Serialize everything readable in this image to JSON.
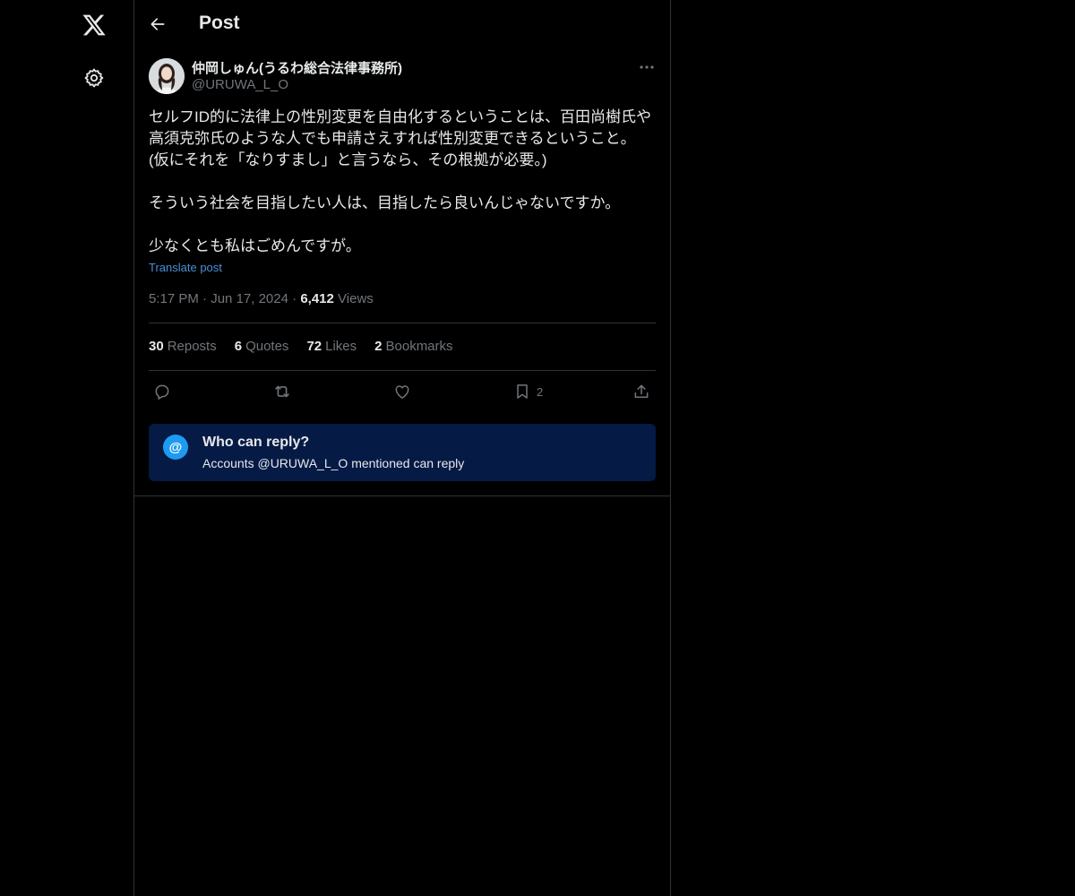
{
  "nav": {
    "logo_icon": "x-logo-icon",
    "settings_icon": "gear-icon"
  },
  "header": {
    "title": "Post",
    "back_icon": "arrow-left-icon"
  },
  "post": {
    "author": {
      "display_name": "仲岡しゅん(うるわ総合法律事務所)",
      "handle": "@URUWA_L_O"
    },
    "text_lines": [
      "セルフID的に法律上の性別変更を自由化するということは、百田尚樹氏や",
      "高須克弥氏のような人でも申請さえすれば性別変更できるということ。",
      "(仮にそれを「なりすまし」と言うなら、その根拠が必要。)",
      "",
      "そういう社会を目指したい人は、目指したら良いんじゃないですか。",
      "",
      "少なくとも私はごめんですが。"
    ],
    "translate_label": "Translate post",
    "time": "5:17 PM",
    "date": "Jun 17, 2024",
    "views_count": "6,412",
    "views_label": "Views",
    "stats": {
      "reposts_count": "30",
      "reposts_label": "Reposts",
      "quotes_count": "6",
      "quotes_label": "Quotes",
      "likes_count": "72",
      "likes_label": "Likes",
      "bookmarks_count": "2",
      "bookmarks_label": "Bookmarks"
    },
    "actions": {
      "bookmark_count": "2"
    }
  },
  "reply_settings": {
    "badge": "@",
    "title": "Who can reply?",
    "subtitle": "Accounts @URUWA_L_O mentioned can reply"
  },
  "colors": {
    "background": "#000000",
    "text": "#e7e9ea",
    "muted": "#71767b",
    "link": "#4a8fd6",
    "border": "#2f3336",
    "reply_box": "#051a45",
    "accent": "#1d9bf0"
  }
}
